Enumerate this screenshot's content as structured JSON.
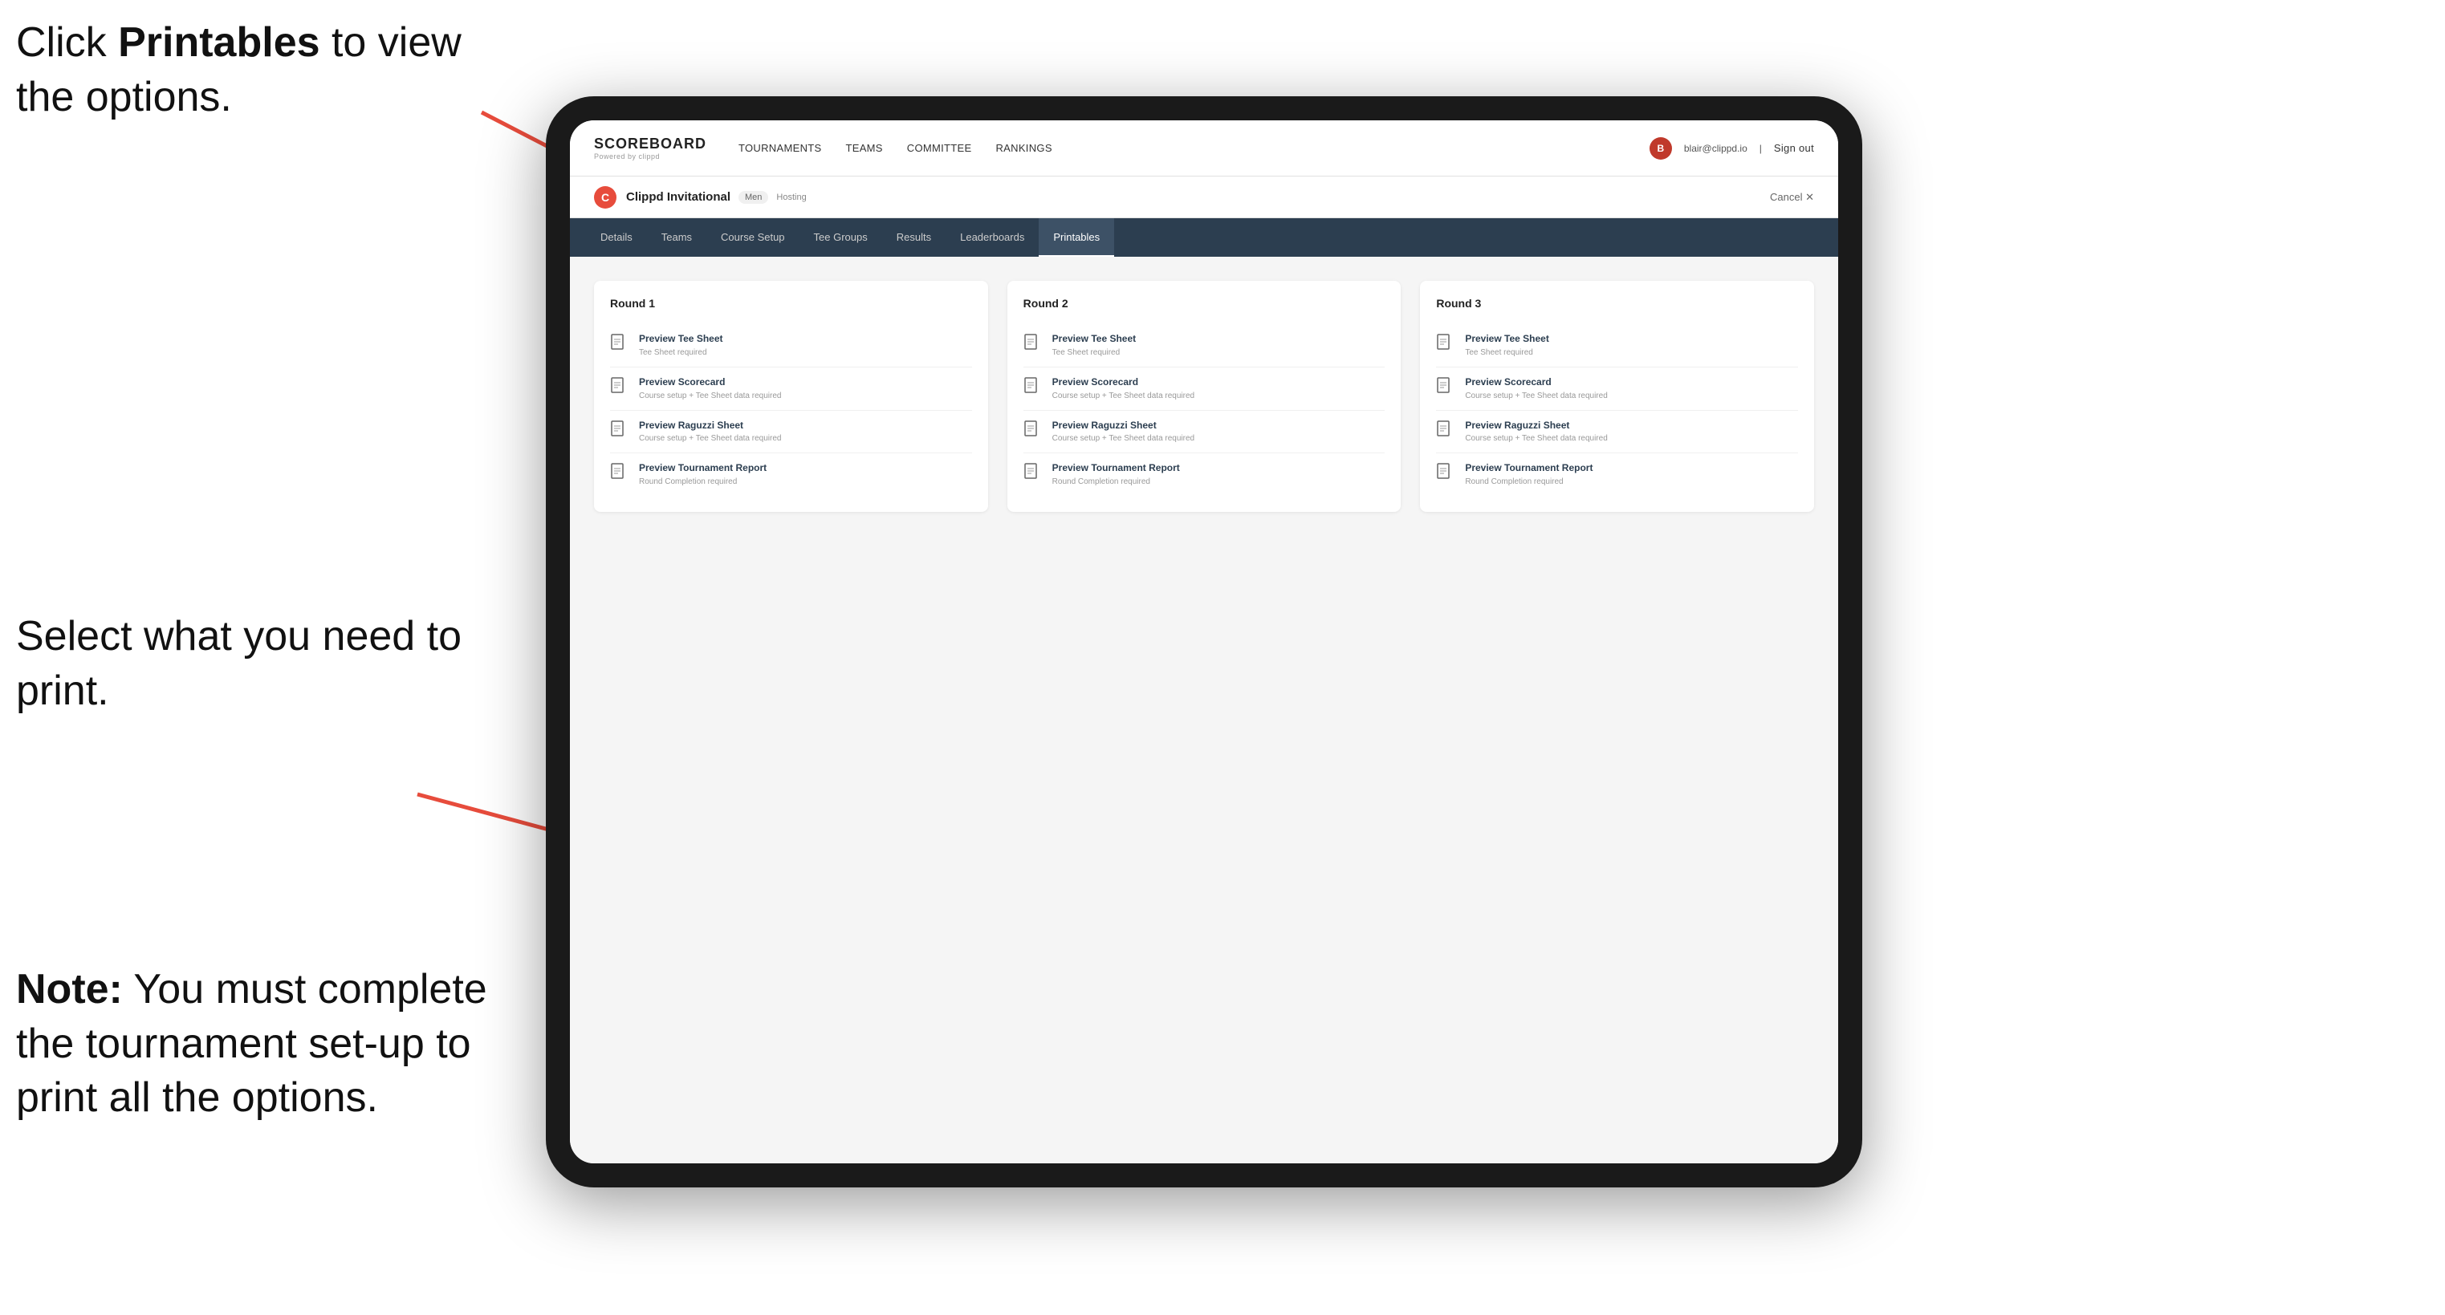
{
  "instructions": {
    "top": "Click ",
    "top_bold": "Printables",
    "top_rest": " to view the options.",
    "middle": "Select what you need to print.",
    "bottom_bold": "Note:",
    "bottom_rest": " You must complete the tournament set-up to print all the options."
  },
  "topNav": {
    "logo_title": "SCOREBOARD",
    "logo_sub": "Powered by clippd",
    "links": [
      "TOURNAMENTS",
      "TEAMS",
      "COMMITTEE",
      "RANKINGS"
    ],
    "user_email": "blair@clippd.io",
    "sign_out": "Sign out"
  },
  "tournament": {
    "name": "Clippd Invitational",
    "badge": "Men",
    "status": "Hosting",
    "cancel": "Cancel ✕"
  },
  "subNav": {
    "tabs": [
      "Details",
      "Teams",
      "Course Setup",
      "Tee Groups",
      "Results",
      "Leaderboards",
      "Printables"
    ],
    "active": "Printables"
  },
  "rounds": [
    {
      "title": "Round 1",
      "items": [
        {
          "label": "Preview Tee Sheet",
          "sub": "Tee Sheet required"
        },
        {
          "label": "Preview Scorecard",
          "sub": "Course setup + Tee Sheet data required"
        },
        {
          "label": "Preview Raguzzi Sheet",
          "sub": "Course setup + Tee Sheet data required"
        },
        {
          "label": "Preview Tournament Report",
          "sub": "Round Completion required"
        }
      ]
    },
    {
      "title": "Round 2",
      "items": [
        {
          "label": "Preview Tee Sheet",
          "sub": "Tee Sheet required"
        },
        {
          "label": "Preview Scorecard",
          "sub": "Course setup + Tee Sheet data required"
        },
        {
          "label": "Preview Raguzzi Sheet",
          "sub": "Course setup + Tee Sheet data required"
        },
        {
          "label": "Preview Tournament Report",
          "sub": "Round Completion required"
        }
      ]
    },
    {
      "title": "Round 3",
      "items": [
        {
          "label": "Preview Tee Sheet",
          "sub": "Tee Sheet required"
        },
        {
          "label": "Preview Scorecard",
          "sub": "Course setup + Tee Sheet data required"
        },
        {
          "label": "Preview Raguzzi Sheet",
          "sub": "Course setup + Tee Sheet data required"
        },
        {
          "label": "Preview Tournament Report",
          "sub": "Round Completion required"
        }
      ]
    }
  ]
}
